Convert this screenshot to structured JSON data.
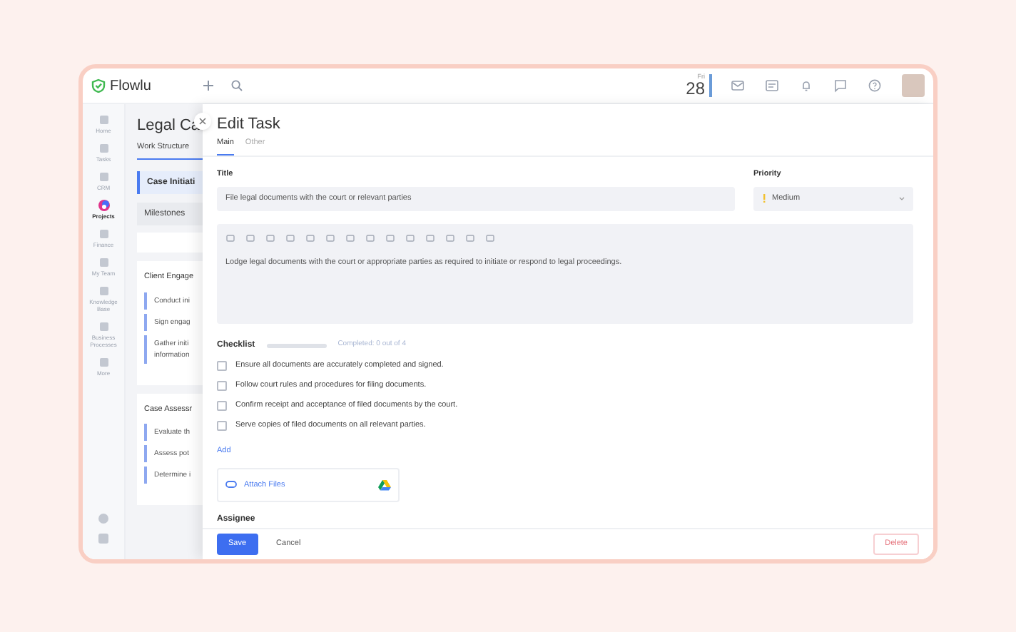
{
  "topbar": {
    "app_name": "Flowlu",
    "date": {
      "weekday": "Fri",
      "day": "28"
    }
  },
  "nav": [
    {
      "label": "Home",
      "selected": false
    },
    {
      "label": "Tasks",
      "selected": false
    },
    {
      "label": "CRM",
      "selected": false
    },
    {
      "label": "Projects",
      "selected": true
    },
    {
      "label": "Finance",
      "selected": false
    },
    {
      "label": "My Team",
      "selected": false
    },
    {
      "label": "Knowledge Base",
      "selected": false
    },
    {
      "label": "Business Processes",
      "selected": false
    },
    {
      "label": "More",
      "selected": false
    }
  ],
  "project": {
    "title": "Legal Ca",
    "tab": "Work Structure",
    "stage": "Case Initiati",
    "milestones": "Milestones",
    "groups": [
      {
        "title": "Client Engage",
        "tasks": [
          "Conduct ini",
          "Sign engag",
          "Gather initi\ninformation"
        ]
      },
      {
        "title": "Case Assessr",
        "tasks": [
          "Evaluate th",
          "Assess pot",
          "Determine i"
        ]
      }
    ]
  },
  "edit_task": {
    "heading": "Edit Task",
    "tabs": [
      {
        "label": "Main",
        "selected": true
      },
      {
        "label": "Other",
        "selected": false
      }
    ],
    "title_label": "Title",
    "title_value": "File legal documents with the court or relevant parties",
    "priority_label": "Priority",
    "priority_value": "Medium",
    "description": "Lodge legal documents with the court or appropriate parties as required to initiate or respond to legal proceedings.",
    "checklist": {
      "label": "Checklist",
      "level": 0,
      "progress_text": "Completed: 0 out of 4",
      "items": [
        {
          "text": "Ensure all documents are accurately completed and signed.",
          "checked": false
        },
        {
          "text": "Follow court rules and procedures for filing documents.",
          "checked": false
        },
        {
          "text": "Confirm receipt and acceptance of filed documents by the court.",
          "checked": false
        },
        {
          "text": "Serve copies of filed documents on all relevant parties.",
          "checked": false
        }
      ],
      "add": "Add"
    },
    "attach": "Attach Files",
    "assignee_label": "Assignee",
    "buttons": {
      "save": "Save",
      "cancel": "Cancel",
      "delete": "Delete"
    }
  }
}
